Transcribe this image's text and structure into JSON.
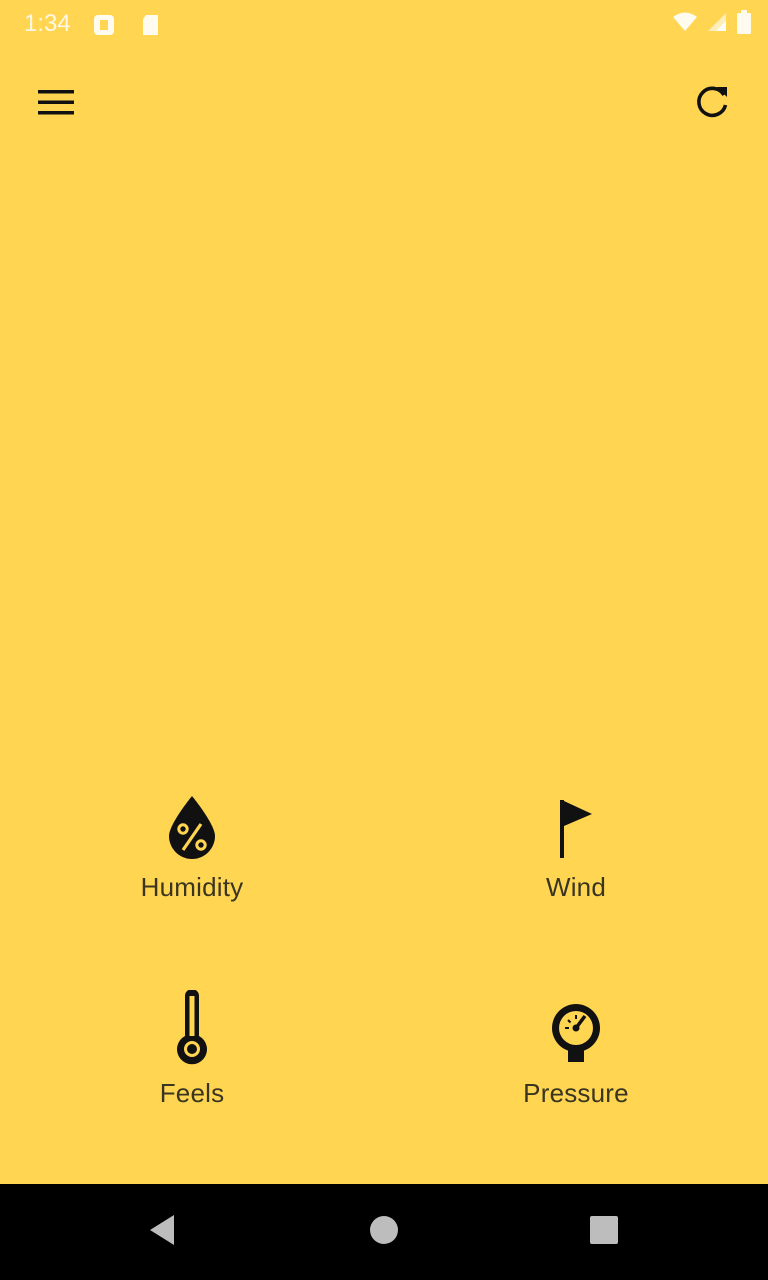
{
  "colors": {
    "background": "#ffd552",
    "icon": "#111111",
    "label": "#3a3520",
    "navbar": "#000000",
    "nav_icon": "#bdbdbd"
  },
  "status_bar": {
    "time": "1:34",
    "left_icons": [
      "notification-icon",
      "sd-card-icon"
    ],
    "right_icons": [
      "wifi-icon",
      "cell-signal-icon",
      "battery-icon"
    ]
  },
  "app_bar": {
    "menu_icon": "hamburger-menu-icon",
    "refresh_icon": "refresh-icon"
  },
  "details": [
    {
      "label": "Humidity",
      "icon": "humidity-drop-icon"
    },
    {
      "label": "Wind",
      "icon": "wind-flag-icon"
    },
    {
      "label": "Feels",
      "icon": "thermometer-icon"
    },
    {
      "label": "Pressure",
      "icon": "pressure-gauge-icon"
    }
  ],
  "nav_bar": {
    "buttons": [
      "back-icon",
      "home-icon",
      "recents-icon"
    ]
  }
}
